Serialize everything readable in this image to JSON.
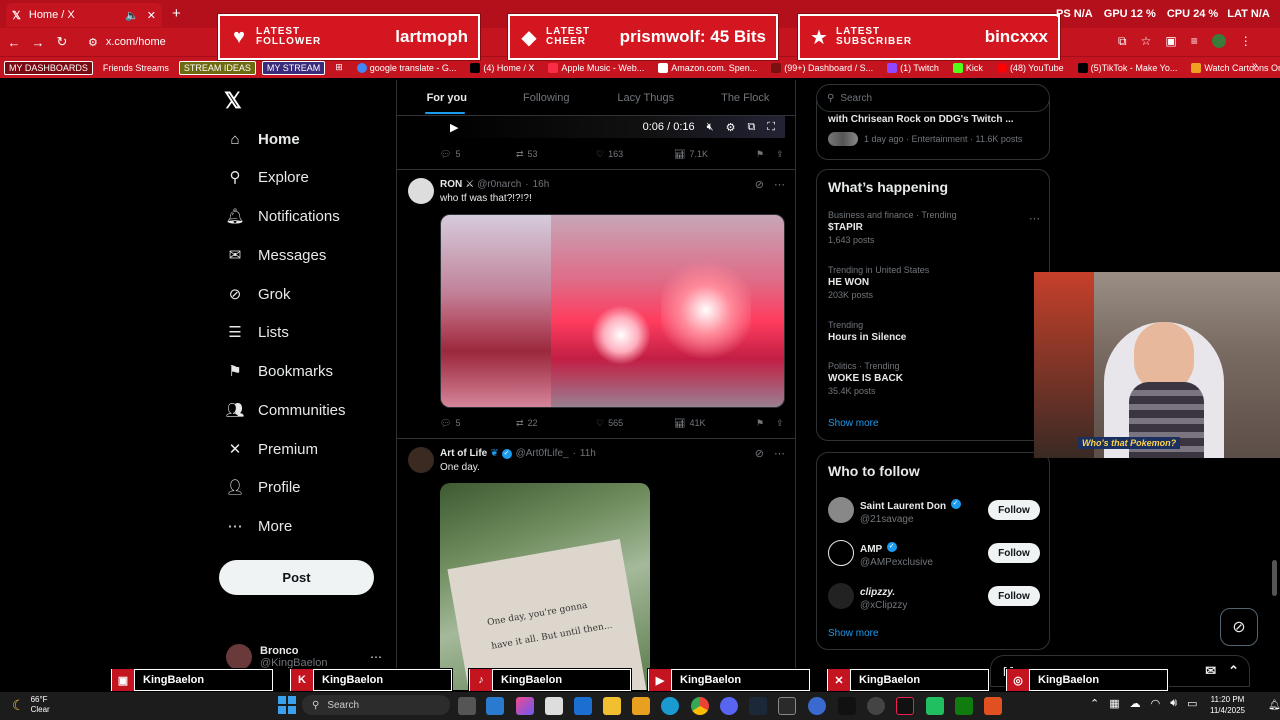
{
  "browser": {
    "tab_title": "Home / X",
    "url": "x.com/home",
    "bookmarks": [
      {
        "label": "MY DASHBOARDS",
        "boxed": true
      },
      {
        "label": "Friends Streams",
        "boxed": false
      },
      {
        "label": "STREAM IDEAS",
        "boxed": true
      },
      {
        "label": "MY STREAM",
        "boxed": true
      },
      {
        "label": "",
        "boxed": false
      },
      {
        "label": "google translate - G...",
        "boxed": false
      },
      {
        "label": "(4) Home / X",
        "boxed": false
      },
      {
        "label": "Apple Music - Web...",
        "boxed": false
      },
      {
        "label": "Amazon.com. Spen...",
        "boxed": false
      },
      {
        "label": "(99+) Dashboard / S...",
        "boxed": false
      },
      {
        "label": "(1) Twitch",
        "boxed": false
      },
      {
        "label": "Kick",
        "boxed": false
      },
      {
        "label": "(48) YouTube",
        "boxed": false
      },
      {
        "label": "(5)TikTok - Make Yo...",
        "boxed": false
      },
      {
        "label": "Watch Cartoons Onl...",
        "boxed": false
      }
    ]
  },
  "overlay": {
    "alerts": [
      {
        "label1": "LATEST",
        "label2": "FOLLOWER",
        "value": "lartmoph",
        "icon": "heart-icon"
      },
      {
        "label1": "LATEST",
        "label2": "CHEER",
        "value": "prismwolf: 45 Bits",
        "icon": "diamond-icon"
      },
      {
        "label1": "LATEST",
        "label2": "SUBSCRIBER",
        "value": "bincxxx",
        "icon": "star-icon"
      }
    ],
    "stats": {
      "fps_label": "PS",
      "fps_value": "N/A",
      "gpu_label": "GPU",
      "gpu_value": "12 %",
      "cpu_label": "CPU",
      "cpu_value": "24 %",
      "lat_label": "LAT",
      "lat_value": "N/A"
    },
    "webcam_caption": "Who's that Pokemon?",
    "socials": [
      {
        "platform": "twitch",
        "name": "KingBaelon"
      },
      {
        "platform": "kick",
        "name": "KingBaelon"
      },
      {
        "platform": "tiktok",
        "name": "KingBaelon"
      },
      {
        "platform": "youtube",
        "name": "KingBaelon"
      },
      {
        "platform": "x",
        "name": "KingBaelon"
      },
      {
        "platform": "instagram",
        "name": "KingBaelon"
      }
    ]
  },
  "nav": {
    "items": [
      {
        "label": "Home",
        "icon": "home-icon"
      },
      {
        "label": "Explore",
        "icon": "search-icon"
      },
      {
        "label": "Notifications",
        "icon": "bell-icon"
      },
      {
        "label": "Messages",
        "icon": "mail-icon"
      },
      {
        "label": "Grok",
        "icon": "grok-icon"
      },
      {
        "label": "Lists",
        "icon": "list-icon"
      },
      {
        "label": "Bookmarks",
        "icon": "bookmark-icon"
      },
      {
        "label": "Communities",
        "icon": "communities-icon"
      },
      {
        "label": "Premium",
        "icon": "x-icon"
      },
      {
        "label": "Profile",
        "icon": "person-icon"
      },
      {
        "label": "More",
        "icon": "more-icon"
      }
    ],
    "post_label": "Post",
    "account_name": "Bronco",
    "account_handle": "@KingBaelon"
  },
  "feed": {
    "tabs": [
      "For you",
      "Following",
      "Lacy Thugs",
      "The Flock"
    ],
    "video_time": "0:06 / 0:16",
    "first_post_stats": {
      "replies": "5",
      "reposts": "53",
      "likes": "163",
      "views": "7.1K"
    },
    "posts": [
      {
        "name": "RON",
        "handle": "@r0narch",
        "time": "16h",
        "text": "who tf was that?!?!?!",
        "replies": "5",
        "reposts": "22",
        "likes": "565",
        "views": "41K"
      },
      {
        "name": "Art of Life",
        "handle": "@Art0fLife_",
        "time": "11h",
        "text": "One day.",
        "book_text": "One day, you're gonna have it all. But until then..."
      }
    ]
  },
  "sidebar": {
    "search_placeholder": "Search",
    "top_story": {
      "title": "with Chrisean Rock on DDG's Twitch ...",
      "meta": "1 day ago · Entertainment · 11.6K posts"
    },
    "happening_title": "What’s happening",
    "trends": [
      {
        "meta": "Business and finance · Trending",
        "name": "$TAPIR",
        "count": "1,643 posts"
      },
      {
        "meta": "Trending in United States",
        "name": "HE WON",
        "count": "203K posts"
      },
      {
        "meta": "Trending",
        "name": "Hours in Silence",
        "count": ""
      },
      {
        "meta": "Politics · Trending",
        "name": "WOKE IS BACK",
        "count": "35.4K posts"
      }
    ],
    "show_more": "Show more",
    "follow_title": "Who to follow",
    "follow": [
      {
        "name": "Saint Laurent Don",
        "handle": "@21savage",
        "verified": true,
        "button": "Follow"
      },
      {
        "name": "AMP",
        "handle": "@AMPexclusive",
        "verified": true,
        "button": "Follow"
      },
      {
        "name": "clipzzy.",
        "handle": "@xClipzzy",
        "verified": false,
        "button": "Follow"
      }
    ],
    "follow_show_more": "Show more",
    "messages_label": "Messages"
  },
  "taskbar": {
    "weather_temp": "66°F",
    "weather_desc": "Clear",
    "search_label": "Search",
    "time": "11:20 PM",
    "date": "11/4/2025"
  }
}
